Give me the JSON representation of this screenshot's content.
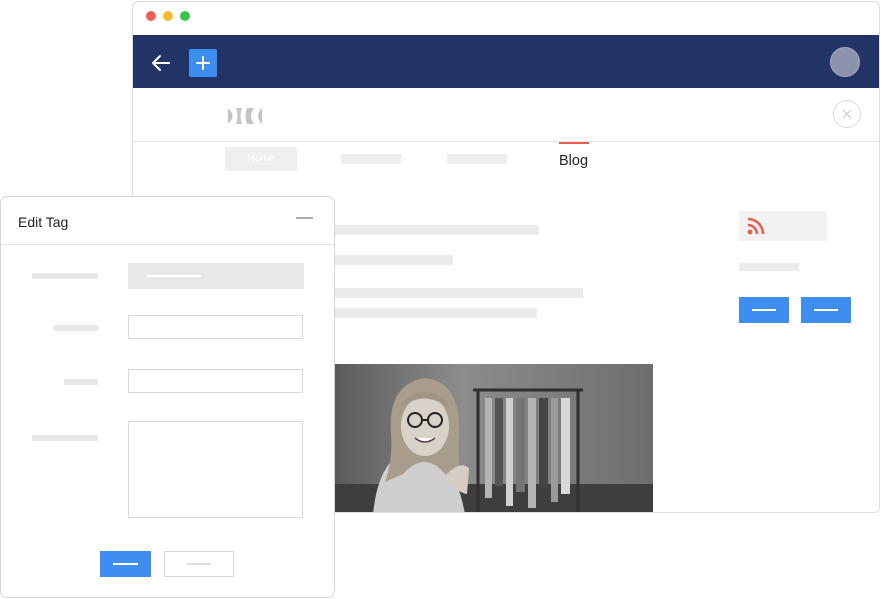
{
  "window": {
    "traffic_lights": [
      "#ec5f57",
      "#f5bb2f",
      "#3cc347"
    ]
  },
  "topbar": {
    "background": "#223365",
    "back_icon": "arrow-left-icon",
    "add_icon": "plus-icon",
    "accent": "#3d8ef0"
  },
  "site": {
    "logo_icon": "brand-logo-icon",
    "close_icon": "close-icon",
    "nav": {
      "home_label": "Home",
      "blog_label": "Blog",
      "active_color": "#e8604c"
    },
    "sidebar": {
      "rss_icon": "rss-icon",
      "rss_color": "#e8604c"
    },
    "photo_icon": "woman-photo"
  },
  "dialog": {
    "title": "Edit Tag",
    "minimize_icon": "minimize-icon"
  }
}
